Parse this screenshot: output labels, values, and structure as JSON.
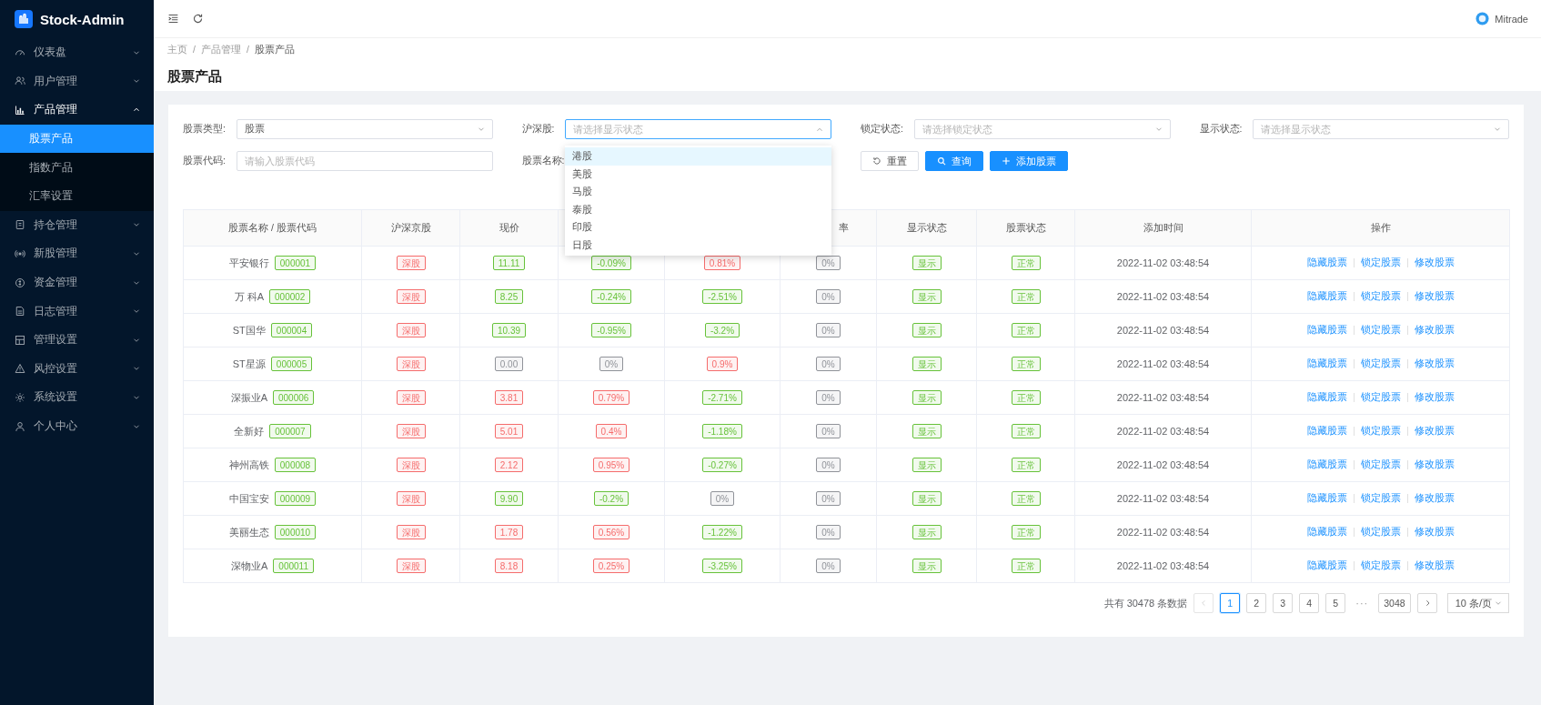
{
  "brand": {
    "name": "Stock-Admin"
  },
  "sidebar": {
    "items": [
      {
        "label": "仪表盘",
        "expanded": false
      },
      {
        "label": "用户管理",
        "expanded": false
      },
      {
        "label": "产品管理",
        "expanded": true,
        "children": [
          {
            "label": "股票产品",
            "selected": true
          },
          {
            "label": "指数产品",
            "selected": false
          },
          {
            "label": "汇率设置",
            "selected": false
          }
        ]
      },
      {
        "label": "持仓管理",
        "expanded": false
      },
      {
        "label": "新股管理",
        "expanded": false
      },
      {
        "label": "资金管理",
        "expanded": false
      },
      {
        "label": "日志管理",
        "expanded": false
      },
      {
        "label": "管理设置",
        "expanded": false
      },
      {
        "label": "风控设置",
        "expanded": false
      },
      {
        "label": "系统设置",
        "expanded": false
      },
      {
        "label": "个人中心",
        "expanded": false
      }
    ]
  },
  "header": {
    "user": "Mitrade"
  },
  "breadcrumb": {
    "items": [
      "主页",
      "产品管理",
      "股票产品"
    ],
    "separator": "/"
  },
  "page_title": "股票产品",
  "filters": [
    {
      "label": "股票类型:",
      "kind": "select",
      "value": "股票",
      "open": false
    },
    {
      "label": "沪深股:",
      "kind": "select",
      "placeholder": "请选择显示状态",
      "open": true,
      "options": [
        {
          "label": "港股",
          "highlighted": true
        },
        {
          "label": "美股",
          "highlighted": false
        },
        {
          "label": "马股",
          "highlighted": false
        },
        {
          "label": "泰股",
          "highlighted": false
        },
        {
          "label": "印股",
          "highlighted": false
        },
        {
          "label": "日股",
          "highlighted": false
        }
      ]
    },
    {
      "label": "锁定状态:",
      "kind": "select",
      "placeholder": "请选择锁定状态",
      "open": false
    },
    {
      "label": "显示状态:",
      "kind": "select",
      "placeholder": "请选择显示状态",
      "open": false
    },
    {
      "label": "股票代码:",
      "kind": "input",
      "placeholder": "请输入股票代码"
    },
    {
      "label": "股票名称:",
      "kind": "covered"
    }
  ],
  "buttons": [
    {
      "label": "重置",
      "kind": "default"
    },
    {
      "label": "查询",
      "kind": "primary"
    },
    {
      "label": "添加股票",
      "kind": "primary"
    }
  ],
  "table": {
    "columns": [
      "股票名称 / 股票代码",
      "沪深京股",
      "现价",
      null,
      null,
      "率",
      "显示状态",
      "股票状态",
      "添加时间",
      "操作"
    ],
    "rows": [
      {
        "name": "平安银行",
        "code": "000001",
        "market": {
          "text": "深股",
          "color": "#f56c6c"
        },
        "price": {
          "text": "11.11",
          "color": "#67c23a"
        },
        "column_4": {
          "text": "-0.09%",
          "color": "#67c23a"
        },
        "column_5": {
          "text": "0.81%",
          "color": "#f56c6c"
        },
        "column_6": {
          "text": "0%",
          "color": "#909399"
        },
        "display": {
          "text": "显示",
          "color": "#67c23a"
        },
        "status": {
          "text": "正常",
          "color": "#67c23a"
        },
        "added": "2022-11-02 03:48:54",
        "actions": [
          "隐藏股票",
          "锁定股票",
          "修改股票"
        ]
      },
      {
        "name": "万 科A",
        "code": "000002",
        "market": {
          "text": "深股",
          "color": "#f56c6c"
        },
        "price": {
          "text": "8.25",
          "color": "#67c23a"
        },
        "column_4": {
          "text": "-0.24%",
          "color": "#67c23a"
        },
        "column_5": {
          "text": "-2.51%",
          "color": "#67c23a"
        },
        "column_6": {
          "text": "0%",
          "color": "#909399"
        },
        "display": {
          "text": "显示",
          "color": "#67c23a"
        },
        "status": {
          "text": "正常",
          "color": "#67c23a"
        },
        "added": "2022-11-02 03:48:54",
        "actions": [
          "隐藏股票",
          "锁定股票",
          "修改股票"
        ]
      },
      {
        "name": "ST国华",
        "code": "000004",
        "market": {
          "text": "深股",
          "color": "#f56c6c"
        },
        "price": {
          "text": "10.39",
          "color": "#67c23a"
        },
        "column_4": {
          "text": "-0.95%",
          "color": "#67c23a"
        },
        "column_5": {
          "text": "-3.2%",
          "color": "#67c23a"
        },
        "column_6": {
          "text": "0%",
          "color": "#909399"
        },
        "display": {
          "text": "显示",
          "color": "#67c23a"
        },
        "status": {
          "text": "正常",
          "color": "#67c23a"
        },
        "added": "2022-11-02 03:48:54",
        "actions": [
          "隐藏股票",
          "锁定股票",
          "修改股票"
        ]
      },
      {
        "name": "ST星源",
        "code": "000005",
        "market": {
          "text": "深股",
          "color": "#f56c6c"
        },
        "price": {
          "text": "0.00",
          "color": "#909399"
        },
        "column_4": {
          "text": "0%",
          "color": "#909399"
        },
        "column_5": {
          "text": "0.9%",
          "color": "#f56c6c"
        },
        "column_6": {
          "text": "0%",
          "color": "#909399"
        },
        "display": {
          "text": "显示",
          "color": "#67c23a"
        },
        "status": {
          "text": "正常",
          "color": "#67c23a"
        },
        "added": "2022-11-02 03:48:54",
        "actions": [
          "隐藏股票",
          "锁定股票",
          "修改股票"
        ]
      },
      {
        "name": "深振业A",
        "code": "000006",
        "market": {
          "text": "深股",
          "color": "#f56c6c"
        },
        "price": {
          "text": "3.81",
          "color": "#f56c6c"
        },
        "column_4": {
          "text": "0.79%",
          "color": "#f56c6c"
        },
        "column_5": {
          "text": "-2.71%",
          "color": "#67c23a"
        },
        "column_6": {
          "text": "0%",
          "color": "#909399"
        },
        "display": {
          "text": "显示",
          "color": "#67c23a"
        },
        "status": {
          "text": "正常",
          "color": "#67c23a"
        },
        "added": "2022-11-02 03:48:54",
        "actions": [
          "隐藏股票",
          "锁定股票",
          "修改股票"
        ]
      },
      {
        "name": "全新好",
        "code": "000007",
        "market": {
          "text": "深股",
          "color": "#f56c6c"
        },
        "price": {
          "text": "5.01",
          "color": "#f56c6c"
        },
        "column_4": {
          "text": "0.4%",
          "color": "#f56c6c"
        },
        "column_5": {
          "text": "-1.18%",
          "color": "#67c23a"
        },
        "column_6": {
          "text": "0%",
          "color": "#909399"
        },
        "display": {
          "text": "显示",
          "color": "#67c23a"
        },
        "status": {
          "text": "正常",
          "color": "#67c23a"
        },
        "added": "2022-11-02 03:48:54",
        "actions": [
          "隐藏股票",
          "锁定股票",
          "修改股票"
        ]
      },
      {
        "name": "神州高铁",
        "code": "000008",
        "market": {
          "text": "深股",
          "color": "#f56c6c"
        },
        "price": {
          "text": "2.12",
          "color": "#f56c6c"
        },
        "column_4": {
          "text": "0.95%",
          "color": "#f56c6c"
        },
        "column_5": {
          "text": "-0.27%",
          "color": "#67c23a"
        },
        "column_6": {
          "text": "0%",
          "color": "#909399"
        },
        "display": {
          "text": "显示",
          "color": "#67c23a"
        },
        "status": {
          "text": "正常",
          "color": "#67c23a"
        },
        "added": "2022-11-02 03:48:54",
        "actions": [
          "隐藏股票",
          "锁定股票",
          "修改股票"
        ]
      },
      {
        "name": "中国宝安",
        "code": "000009",
        "market": {
          "text": "深股",
          "color": "#f56c6c"
        },
        "price": {
          "text": "9.90",
          "color": "#67c23a"
        },
        "column_4": {
          "text": "-0.2%",
          "color": "#67c23a"
        },
        "column_5": {
          "text": "0%",
          "color": "#909399"
        },
        "column_6": {
          "text": "0%",
          "color": "#909399"
        },
        "display": {
          "text": "显示",
          "color": "#67c23a"
        },
        "status": {
          "text": "正常",
          "color": "#67c23a"
        },
        "added": "2022-11-02 03:48:54",
        "actions": [
          "隐藏股票",
          "锁定股票",
          "修改股票"
        ]
      },
      {
        "name": "美丽生态",
        "code": "000010",
        "market": {
          "text": "深股",
          "color": "#f56c6c"
        },
        "price": {
          "text": "1.78",
          "color": "#f56c6c"
        },
        "column_4": {
          "text": "0.56%",
          "color": "#f56c6c"
        },
        "column_5": {
          "text": "-1.22%",
          "color": "#67c23a"
        },
        "column_6": {
          "text": "0%",
          "color": "#909399"
        },
        "display": {
          "text": "显示",
          "color": "#67c23a"
        },
        "status": {
          "text": "正常",
          "color": "#67c23a"
        },
        "added": "2022-11-02 03:48:54",
        "actions": [
          "隐藏股票",
          "锁定股票",
          "修改股票"
        ]
      },
      {
        "name": "深物业A",
        "code": "000011",
        "market": {
          "text": "深股",
          "color": "#f56c6c"
        },
        "price": {
          "text": "8.18",
          "color": "#f56c6c"
        },
        "column_4": {
          "text": "0.25%",
          "color": "#f56c6c"
        },
        "column_5": {
          "text": "-3.25%",
          "color": "#67c23a"
        },
        "column_6": {
          "text": "0%",
          "color": "#909399"
        },
        "display": {
          "text": "显示",
          "color": "#67c23a"
        },
        "status": {
          "text": "正常",
          "color": "#67c23a"
        },
        "added": "2022-11-02 03:48:54",
        "actions": [
          "隐藏股票",
          "锁定股票",
          "修改股票"
        ]
      }
    ]
  },
  "pagination": {
    "total": "共有 30478 条数据",
    "prev": {
      "disabled": true
    },
    "next": {
      "disabled": false
    },
    "pages": [
      {
        "label": "1",
        "kind": "page",
        "selected": true
      },
      {
        "label": "2",
        "kind": "page",
        "selected": false
      },
      {
        "label": "3",
        "kind": "page",
        "selected": false
      },
      {
        "label": "4",
        "kind": "page",
        "selected": false
      },
      {
        "label": "5",
        "kind": "page",
        "selected": false
      },
      {
        "label": "···",
        "kind": "ellipsis"
      },
      {
        "label": "3048",
        "kind": "page",
        "selected": false
      }
    ],
    "page_size": "10 条/页"
  }
}
